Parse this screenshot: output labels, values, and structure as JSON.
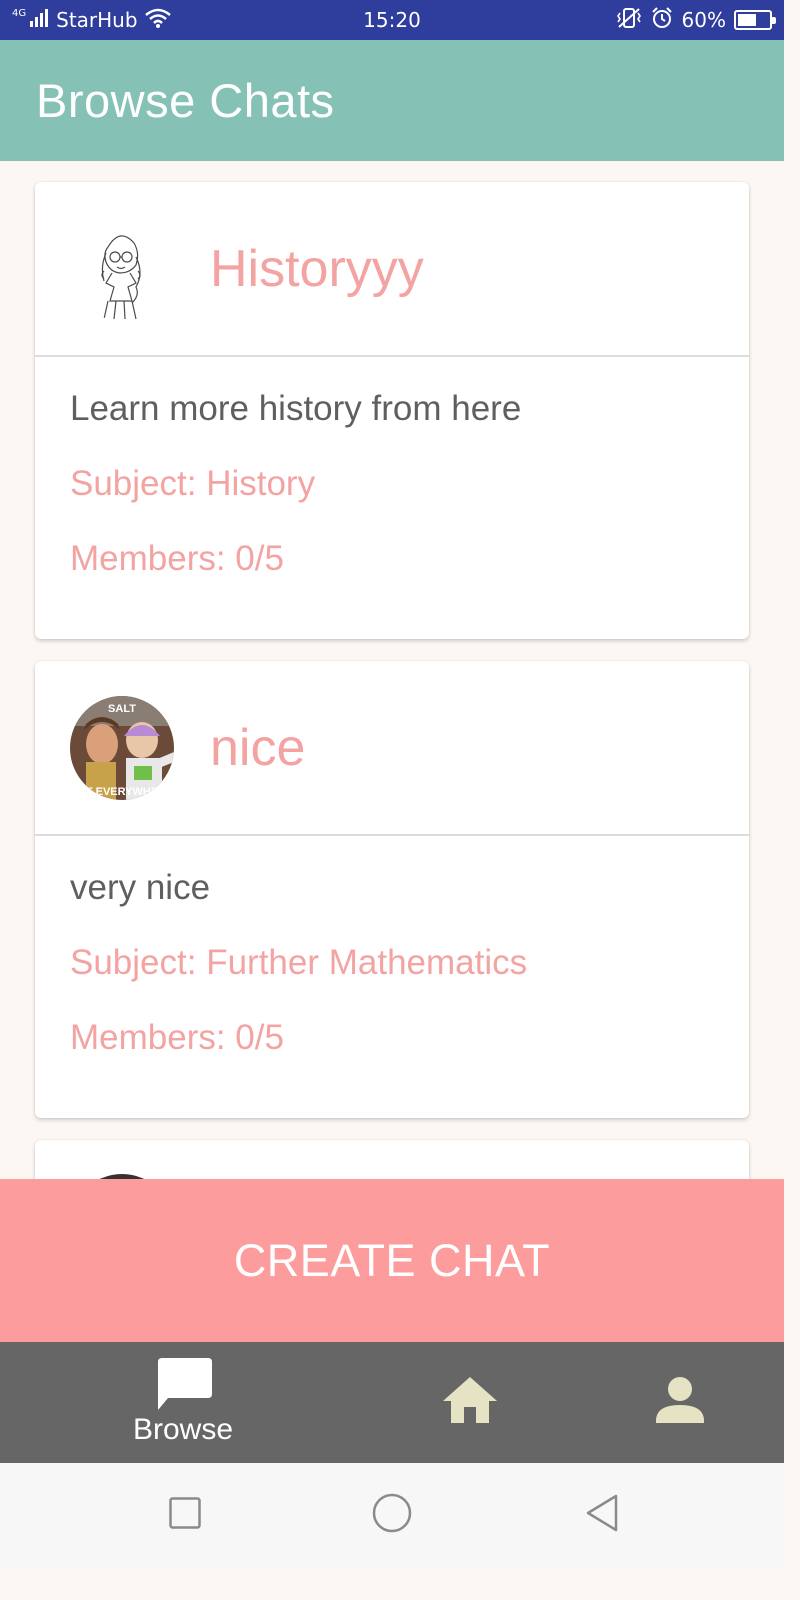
{
  "status_bar": {
    "network_type": "4G",
    "carrier": "StarHub",
    "time": "15:20",
    "battery_percent": "60%",
    "battery_level": 0.6,
    "icons": [
      "signal-icon",
      "wifi-icon",
      "vibrate-icon",
      "alarm-icon",
      "battery-icon"
    ]
  },
  "app_bar": {
    "title": "Browse Chats"
  },
  "chats": [
    {
      "name": "Historyyy",
      "description": "Learn more history from here",
      "subject": "Subject: History",
      "members": "Members: 0/5",
      "avatar": "girl-sketch-avatar"
    },
    {
      "name": "nice",
      "description": "very nice",
      "subject": "Subject: Further Mathematics",
      "members": "Members: 0/5",
      "avatar": "toy-story-meme-avatar",
      "avatar_text_top": "SALT",
      "avatar_text_bottom": "T EVERYWHE"
    }
  ],
  "create_button": {
    "label": "CREATE CHAT",
    "color": "#fd9c9c"
  },
  "bottom_nav": {
    "items": [
      {
        "label": "Browse",
        "icon": "chat-bubble-icon",
        "active": true
      },
      {
        "label": "",
        "icon": "home-icon",
        "active": false
      },
      {
        "label": "",
        "icon": "person-icon",
        "active": false
      }
    ]
  },
  "system_nav": {
    "icons": [
      "recents-square-icon",
      "home-circle-icon",
      "back-triangle-icon"
    ]
  },
  "colors": {
    "status_bar": "#2f3d9c",
    "app_bar": "#86c1b6",
    "accent_pink": "#f4a3a3",
    "bottom_nav": "#666666",
    "nav_icon": "#e6e3c4"
  }
}
